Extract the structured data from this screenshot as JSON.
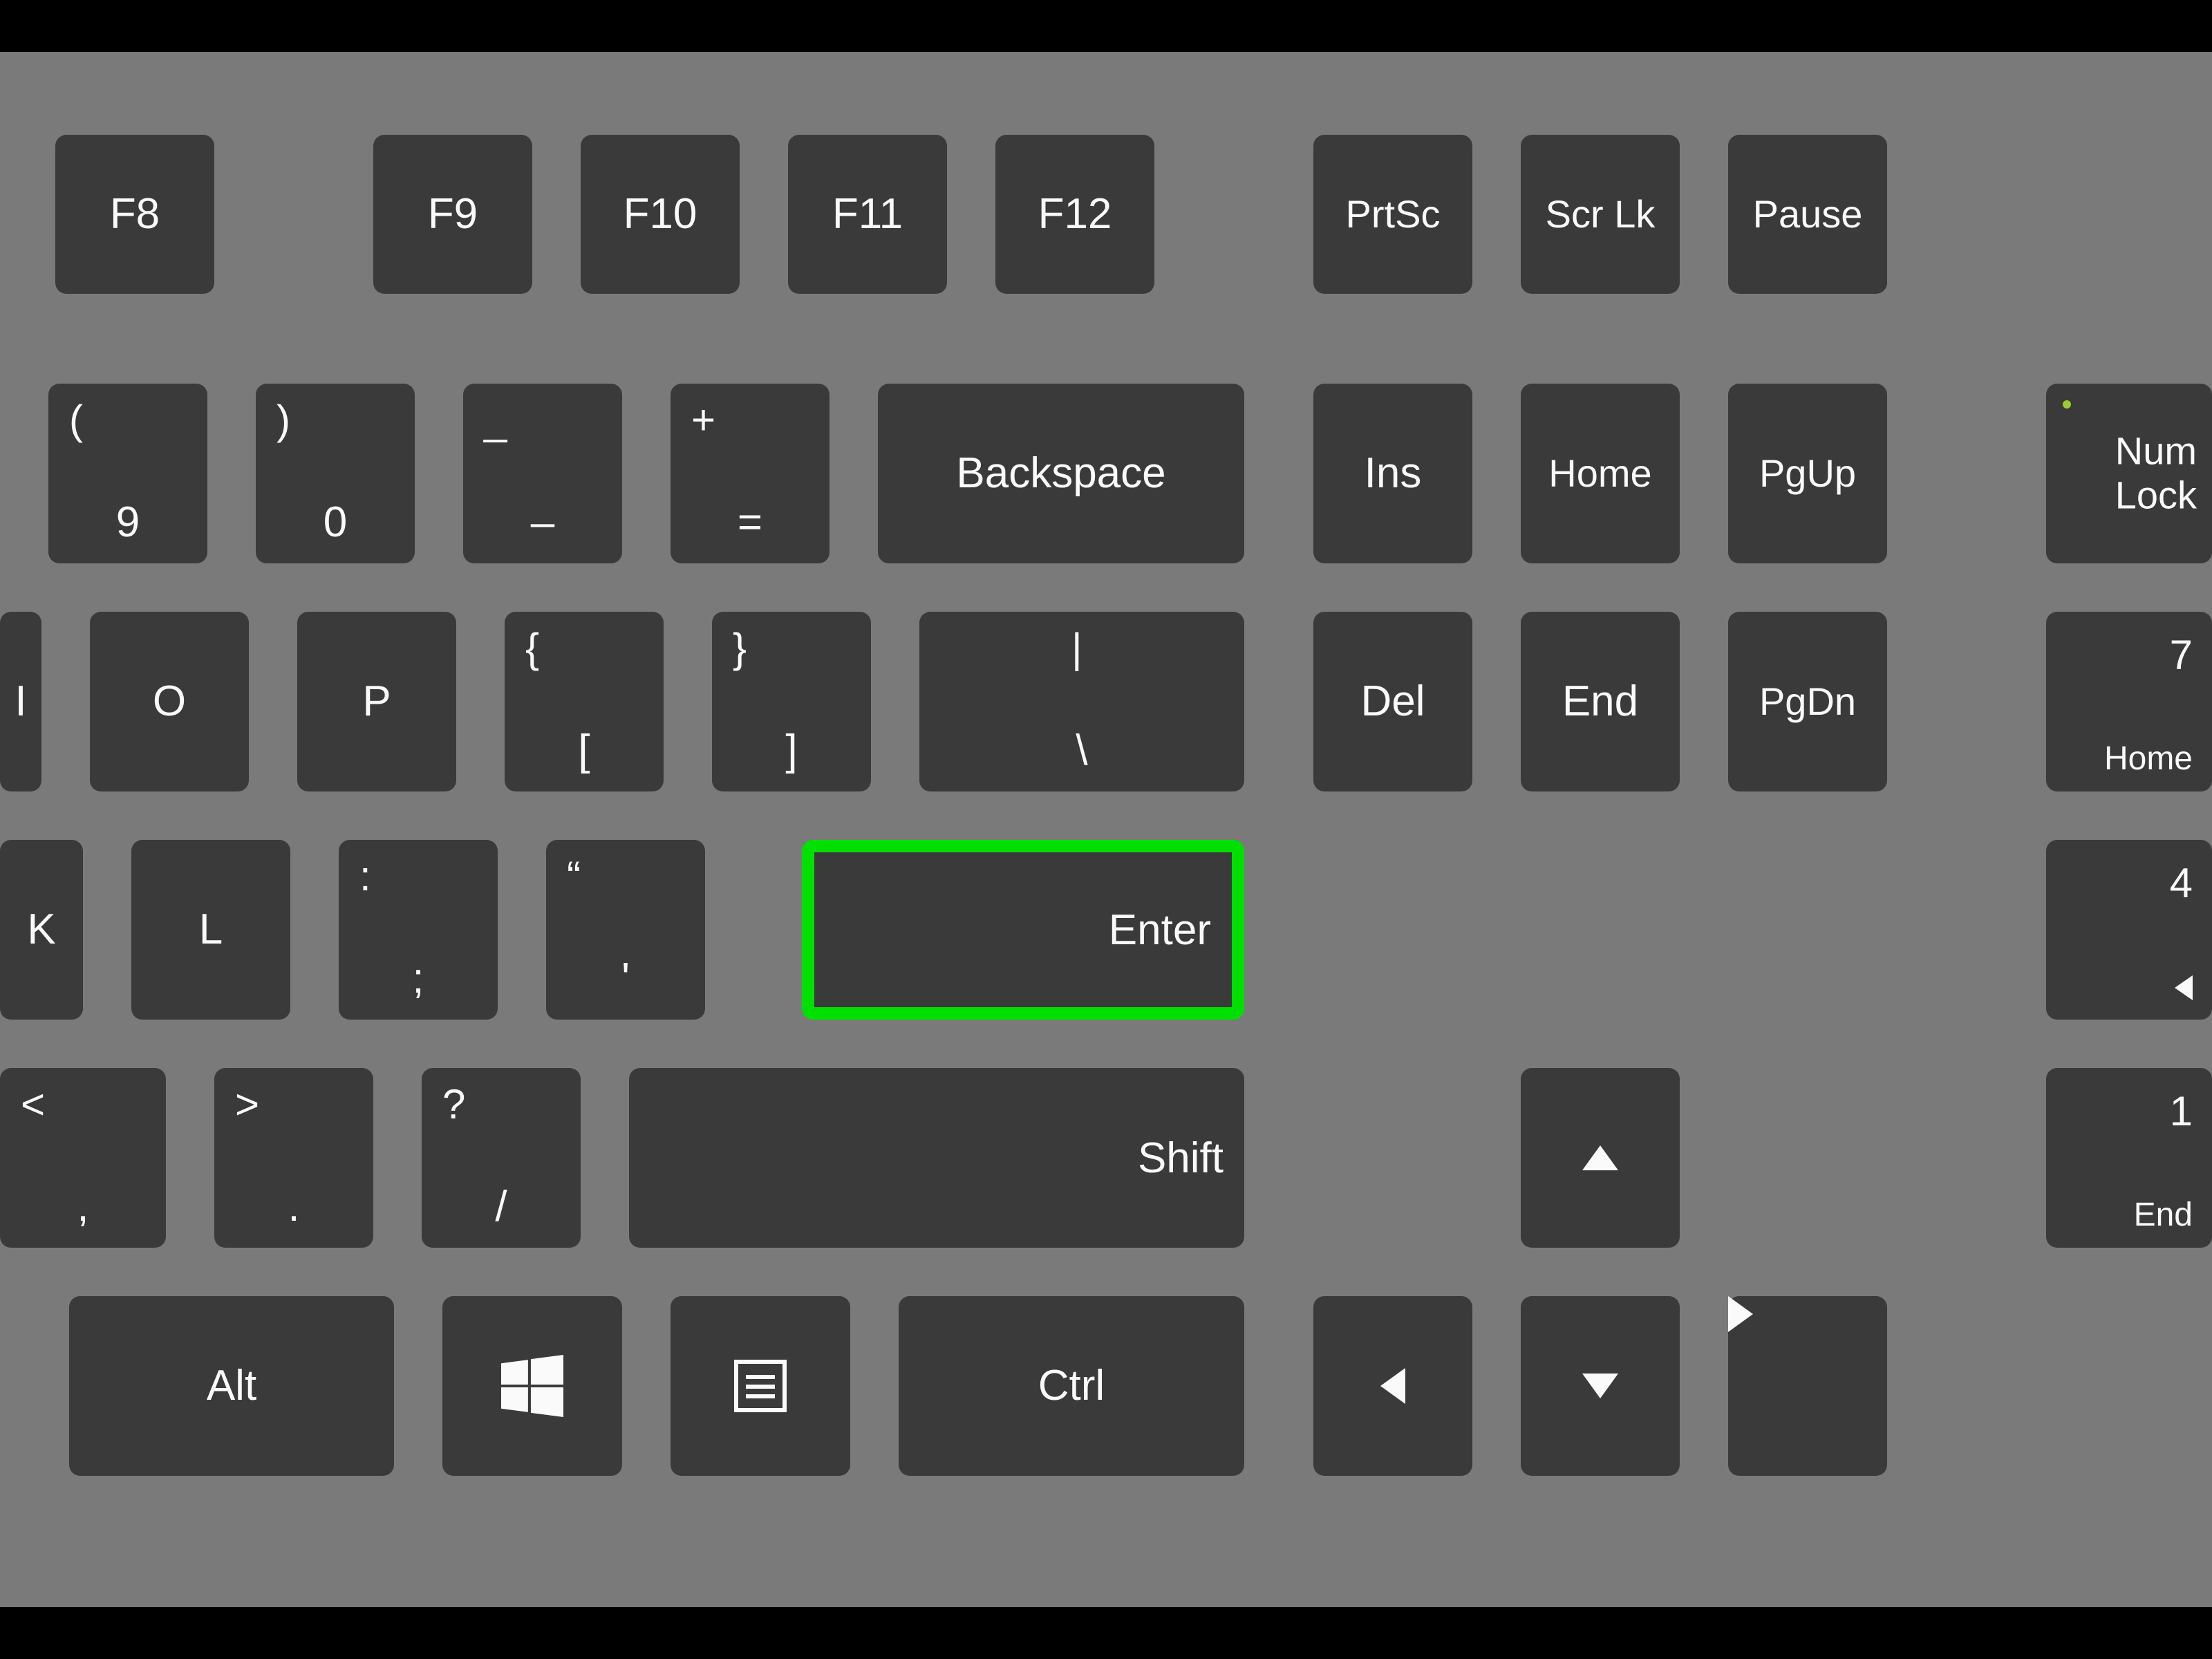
{
  "row1": {
    "f8": "F8",
    "f9": "F9",
    "f10": "F10",
    "f11": "F11",
    "f12": "F12",
    "prtsc": "PrtSc",
    "scrlk": "Scr Lk",
    "pause": "Pause"
  },
  "row2": {
    "nine_upper": "(",
    "nine_lower": "9",
    "zero_upper": ")",
    "zero_lower": "0",
    "minus_upper": "_",
    "minus_lower": "–",
    "equals_upper": "+",
    "equals_lower": "=",
    "backspace": "Backspace",
    "ins": "Ins",
    "home": "Home",
    "pgup": "PgUp",
    "numlock": "Num\nLock"
  },
  "row3": {
    "i": "I",
    "o": "O",
    "p": "P",
    "lbrack_upper": "{",
    "lbrack_lower": "[",
    "rbrack_upper": "}",
    "rbrack_lower": "]",
    "bslash_upper": "|",
    "bslash_lower": "\\",
    "del": "Del",
    "end": "End",
    "pgdn": "PgDn",
    "np7_main": "7",
    "np7_sub": "Home"
  },
  "row4": {
    "k": "K",
    "l": "L",
    "semi_upper": ":",
    "semi_lower": ";",
    "quote_upper": "“",
    "quote_lower": "'",
    "enter": "Enter",
    "np4_main": "4"
  },
  "row5": {
    "comma_upper": "<",
    "comma_lower": ",",
    "period_upper": ">",
    "period_lower": ".",
    "slash_upper": "?",
    "slash_lower": "/",
    "shift": "Shift",
    "np1_main": "1",
    "np1_sub": "End"
  },
  "row6": {
    "alt": "Alt",
    "ctrl": "Ctrl"
  },
  "highlight_key": "enter"
}
